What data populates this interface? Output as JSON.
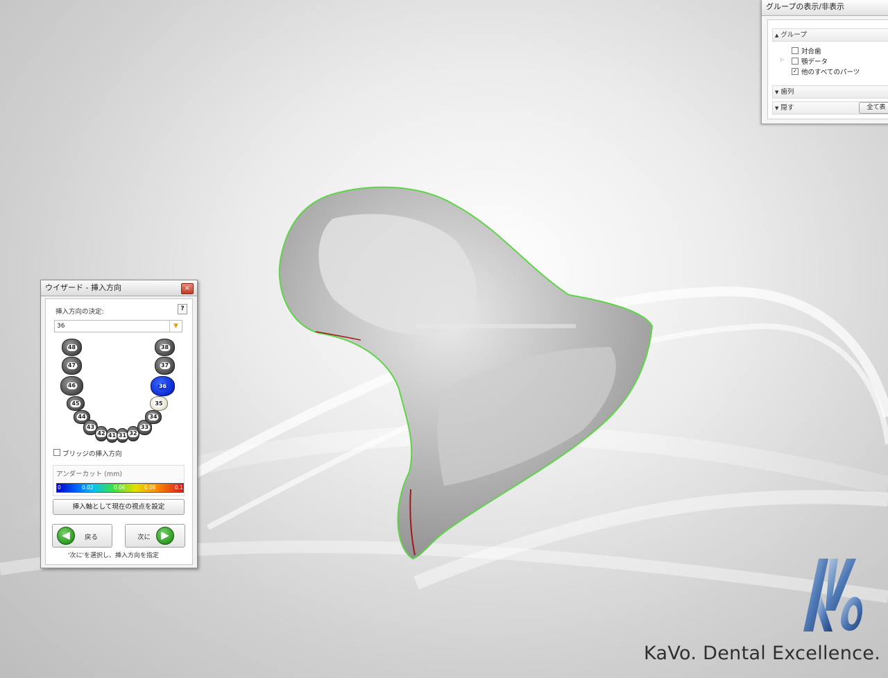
{
  "wizard": {
    "title": "ウイザード - 挿入方向",
    "close_glyph": "×",
    "insertion_label": "挿入方向の決定:",
    "help_glyph": "?",
    "tooth_select": {
      "value": "36"
    },
    "teeth": {
      "t48": "48",
      "t47": "47",
      "t46": "46",
      "t45": "45",
      "t44": "44",
      "t43": "43",
      "t42": "42",
      "t41": "41",
      "t31": "31",
      "t32": "32",
      "t33": "33",
      "t34": "34",
      "t35": "35",
      "t36": "36",
      "t37": "37",
      "t38": "38"
    },
    "selected_tooth": "36",
    "bridge_checkbox_label": "ブリッジの挿入方向",
    "bridge_checked": false,
    "undercut": {
      "label": "アンダーカット (mm)",
      "ticks": [
        "0",
        "0.02",
        "0.06",
        "0.08",
        "0.1"
      ]
    },
    "set_view_button": "挿入軸として現在の視点を設定",
    "back_button": "戻る",
    "next_button": "次に",
    "hint": "'次に'を選択し、挿入方向を指定"
  },
  "groups_panel": {
    "title": "グループの表示/非表示",
    "group_section": "グループ",
    "items": [
      {
        "label": "対合歯",
        "checked": false,
        "expandable": false
      },
      {
        "label": "顎データ",
        "checked": false,
        "expandable": true
      },
      {
        "label": "他のすべてのパーツ",
        "checked": true,
        "expandable": false
      }
    ],
    "dentition_section": "歯列",
    "hide_section": "隠す",
    "show_all_button": "全て表"
  },
  "brand": {
    "tagline": "KaVo. Dental Excellence."
  },
  "colors": {
    "outline": "#5fd44a",
    "selected_tooth": "#0a2bd0",
    "undercut_mark": "#a01818"
  }
}
